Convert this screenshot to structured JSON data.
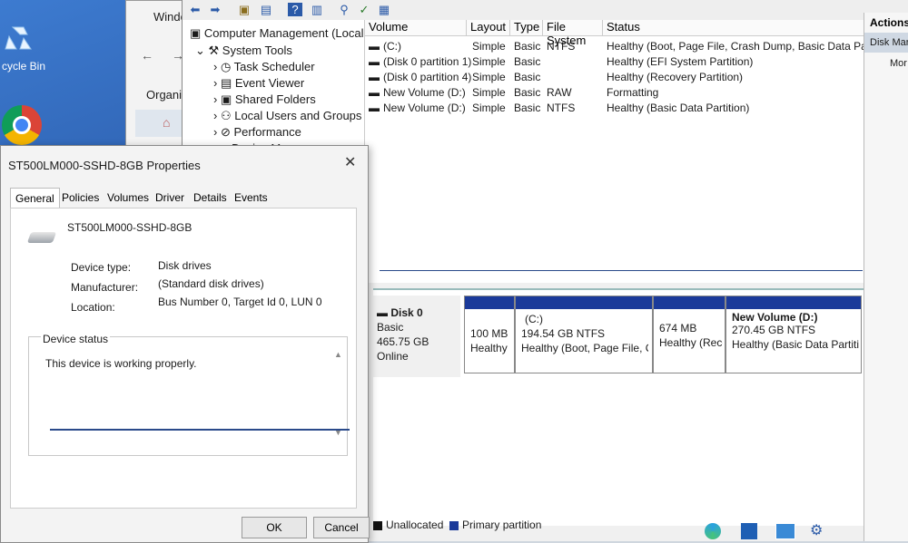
{
  "desktop": {
    "recycle_label": "cycle Bin"
  },
  "explorer": {
    "title": "Windo",
    "organize": "Organize",
    "home": "H"
  },
  "tree": [
    {
      "label": "Computer Management (Local"
    },
    {
      "label": "System Tools"
    },
    {
      "label": "Task Scheduler"
    },
    {
      "label": "Event Viewer"
    },
    {
      "label": "Shared Folders"
    },
    {
      "label": "Local Users and Groups"
    },
    {
      "label": "Performance"
    },
    {
      "label": "Device Manager"
    }
  ],
  "volumes": {
    "headers": [
      "Volume",
      "Layout",
      "Type",
      "File System",
      "Status"
    ],
    "rows": [
      {
        "volume": "(C:)",
        "layout": "Simple",
        "type": "Basic",
        "fs": "NTFS",
        "status": "Healthy (Boot, Page File, Crash Dump, Basic Data Partition)"
      },
      {
        "volume": "(Disk 0 partition 1)",
        "layout": "Simple",
        "type": "Basic",
        "fs": "",
        "status": "Healthy (EFI System Partition)"
      },
      {
        "volume": "(Disk 0 partition 4)",
        "layout": "Simple",
        "type": "Basic",
        "fs": "",
        "status": "Healthy (Recovery Partition)"
      },
      {
        "volume": "New Volume (D:)",
        "layout": "Simple",
        "type": "Basic",
        "fs": "RAW",
        "status": "Formatting"
      },
      {
        "volume": "New Volume (D:)",
        "layout": "Simple",
        "type": "Basic",
        "fs": "NTFS",
        "status": "Healthy (Basic Data Partition)"
      }
    ]
  },
  "actions": {
    "header": "Actions",
    "item1": "Disk Mar",
    "item2": "Mor"
  },
  "disk": {
    "name": "Disk 0",
    "kind": "Basic",
    "size": "465.75 GB",
    "state": "Online",
    "partitions": [
      {
        "title": "",
        "size": "100 MB",
        "status": "Healthy ("
      },
      {
        "title": "(C:)",
        "size": "194.54 GB NTFS",
        "status": "Healthy (Boot, Page File, Cra"
      },
      {
        "title": "",
        "size": "674 MB",
        "status": "Healthy (Recc"
      },
      {
        "title": "New Volume  (D:)",
        "size": "270.45 GB NTFS",
        "status": "Healthy (Basic Data Partition)"
      }
    ],
    "legend_unallocated": "Unallocated",
    "legend_primary": "Primary partition"
  },
  "dialog": {
    "title": "ST500LM000-SSHD-8GB Properties",
    "tabs": [
      "General",
      "Policies",
      "Volumes",
      "Driver",
      "Details",
      "Events"
    ],
    "device_name": "ST500LM000-SSHD-8GB",
    "device_type_label": "Device type:",
    "device_type": "Disk drives",
    "manufacturer_label": "Manufacturer:",
    "manufacturer": "(Standard disk drives)",
    "location_label": "Location:",
    "location": "Bus Number 0, Target Id 0, LUN 0",
    "status_label": "Device status",
    "status_text": "This device is working properly.",
    "ok": "OK",
    "cancel": "Cancel"
  },
  "colors": {
    "primary_partition": "#1b3a9a",
    "unallocated": "#111111"
  }
}
